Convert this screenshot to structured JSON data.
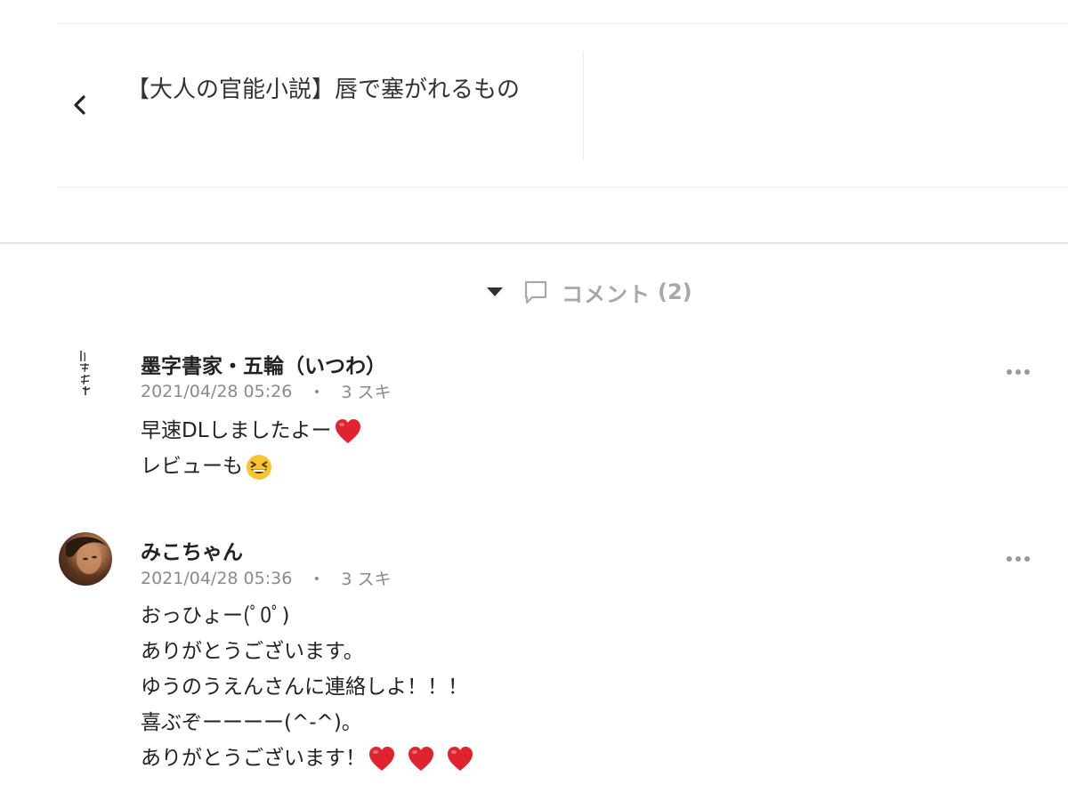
{
  "navigation": {
    "prev_article_title": "【大人の官能小説】唇で塞がれるもの"
  },
  "comments_section": {
    "label": "コメント",
    "count": "(2)"
  },
  "comments": [
    {
      "author": "墨字書家・五輪（いつわ）",
      "timestamp": "2021/04/28 05:26",
      "separator": "・",
      "likes": "3 スキ",
      "lines": [
        {
          "text": "早速DLしましたよー",
          "emoji": [
            "heart"
          ]
        },
        {
          "text": "レビューも",
          "emoji": [
            "grinning-squint"
          ]
        }
      ]
    },
    {
      "author": "みこちゃん",
      "timestamp": "2021/04/28 05:36",
      "separator": "・",
      "likes": "3 スキ",
      "lines": [
        {
          "text": "おっひょー(ﾟ0ﾟ)",
          "emoji": []
        },
        {
          "text": "ありがとうございます。",
          "emoji": []
        },
        {
          "text": "ゆうのうえんさんに連絡しよ！！！",
          "emoji": []
        },
        {
          "text": "喜ぶぞーーーー(^-^)。",
          "emoji": []
        },
        {
          "text": "ありがとうございます！",
          "emoji": [
            "heart",
            "heart",
            "heart"
          ]
        }
      ]
    }
  ],
  "colors": {
    "text": "#222222",
    "meta": "#8a8a8a",
    "muted_label": "#a8a8a8",
    "heart": "#e0242f",
    "divider": "#ececec"
  }
}
